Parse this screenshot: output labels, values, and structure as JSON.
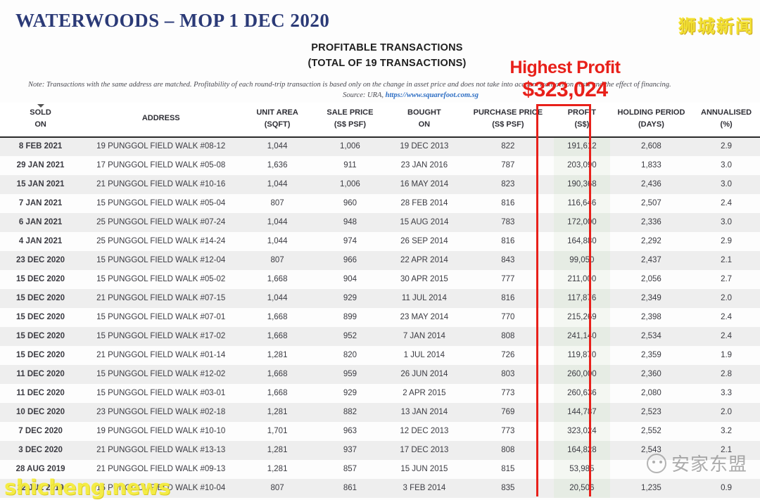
{
  "title": "WATERWOODS – MOP 1 DEC 2020",
  "watermarks": {
    "top_right": "狮城新闻",
    "bottom_left": "shicheng.news",
    "bottom_right": "安家东盟"
  },
  "heading": {
    "line1": "PROFITABLE TRANSACTIONS",
    "line2": "(TOTAL OF 19 TRANSACTIONS)"
  },
  "note": {
    "text": "Note: Transactions with the same address are matched. Profitability of each round-trip transaction is based only on the change in asset price and does not take into account transaction costs and the effect of financing.",
    "source_label": "Source: URA,",
    "source_link": "https://www.squarefoot.com.sg"
  },
  "callout": {
    "label": "Highest Profit",
    "value": "$323,024",
    "color": "#e8201a"
  },
  "colors": {
    "title": "#2b3a77",
    "highlight": "#e8201a",
    "header_sorted_bg": "#cfdce8",
    "row_odd": "#eeeeee",
    "row_even": "#fdfdfd",
    "profit_col": "#e6ece4"
  },
  "table": {
    "columns": [
      {
        "key": "sold_on",
        "line1": "SOLD",
        "line2": "ON",
        "sorted": true
      },
      {
        "key": "address",
        "line1": "ADDRESS",
        "line2": "",
        "sorted": false
      },
      {
        "key": "unit_area",
        "line1": "UNIT AREA",
        "line2": "(SQFT)",
        "sorted": false
      },
      {
        "key": "sale_price",
        "line1": "SALE PRICE",
        "line2": "(S$ PSF)",
        "sorted": false
      },
      {
        "key": "bought_on",
        "line1": "BOUGHT",
        "line2": "ON",
        "sorted": false
      },
      {
        "key": "purchase_price",
        "line1": "PURCHASE PRICE",
        "line2": "(S$ PSF)",
        "sorted": false
      },
      {
        "key": "profit",
        "line1": "PROFIT",
        "line2": "(S$)",
        "sorted": false,
        "highlighted": true
      },
      {
        "key": "holding_period",
        "line1": "HOLDING PERIOD",
        "line2": "(DAYS)",
        "sorted": false
      },
      {
        "key": "annualised",
        "line1": "ANNUALISED",
        "line2": "(%)",
        "sorted": false
      }
    ],
    "rows": [
      [
        "8 FEB 2021",
        "19 PUNGGOL FIELD WALK #08-12",
        "1,044",
        "1,006",
        "19 DEC 2013",
        "822",
        "191,612",
        "2,608",
        "2.9"
      ],
      [
        "29 JAN 2021",
        "17 PUNGGOL FIELD WALK #05-08",
        "1,636",
        "911",
        "23 JAN 2016",
        "787",
        "203,090",
        "1,833",
        "3.0"
      ],
      [
        "15 JAN 2021",
        "21 PUNGGOL FIELD WALK #10-16",
        "1,044",
        "1,006",
        "16 MAY 2014",
        "823",
        "190,368",
        "2,436",
        "3.0"
      ],
      [
        "7 JAN 2021",
        "15 PUNGGOL FIELD WALK #05-04",
        "807",
        "960",
        "28 FEB 2014",
        "816",
        "116,646",
        "2,507",
        "2.4"
      ],
      [
        "6 JAN 2021",
        "25 PUNGGOL FIELD WALK #07-24",
        "1,044",
        "948",
        "15 AUG 2014",
        "783",
        "172,000",
        "2,336",
        "3.0"
      ],
      [
        "4 JAN 2021",
        "25 PUNGGOL FIELD WALK #14-24",
        "1,044",
        "974",
        "26 SEP 2014",
        "816",
        "164,880",
        "2,292",
        "2.9"
      ],
      [
        "23 DEC 2020",
        "15 PUNGGOL FIELD WALK #12-04",
        "807",
        "966",
        "22 APR 2014",
        "843",
        "99,050",
        "2,437",
        "2.1"
      ],
      [
        "15 DEC 2020",
        "15 PUNGGOL FIELD WALK #05-02",
        "1,668",
        "904",
        "30 APR 2015",
        "777",
        "211,000",
        "2,056",
        "2.7"
      ],
      [
        "15 DEC 2020",
        "21 PUNGGOL FIELD WALK #07-15",
        "1,044",
        "929",
        "11 JUL 2014",
        "816",
        "117,876",
        "2,349",
        "2.0"
      ],
      [
        "15 DEC 2020",
        "15 PUNGGOL FIELD WALK #07-01",
        "1,668",
        "899",
        "23 MAY 2014",
        "770",
        "215,269",
        "2,398",
        "2.4"
      ],
      [
        "15 DEC 2020",
        "15 PUNGGOL FIELD WALK #17-02",
        "1,668",
        "952",
        "7 JAN 2014",
        "808",
        "241,140",
        "2,534",
        "2.4"
      ],
      [
        "15 DEC 2020",
        "21 PUNGGOL FIELD WALK #01-14",
        "1,281",
        "820",
        "1 JUL 2014",
        "726",
        "119,870",
        "2,359",
        "1.9"
      ],
      [
        "11 DEC 2020",
        "15 PUNGGOL FIELD WALK #12-02",
        "1,668",
        "959",
        "26 JUN 2014",
        "803",
        "260,000",
        "2,360",
        "2.8"
      ],
      [
        "11 DEC 2020",
        "15 PUNGGOL FIELD WALK #03-01",
        "1,668",
        "929",
        "2 APR 2015",
        "773",
        "260,636",
        "2,080",
        "3.3"
      ],
      [
        "10 DEC 2020",
        "23 PUNGGOL FIELD WALK #02-18",
        "1,281",
        "882",
        "13 JAN 2014",
        "769",
        "144,787",
        "2,523",
        "2.0"
      ],
      [
        "7 DEC 2020",
        "19 PUNGGOL FIELD WALK #10-10",
        "1,701",
        "963",
        "12 DEC 2013",
        "773",
        "323,024",
        "2,552",
        "3.2"
      ],
      [
        "3 DEC 2020",
        "21 PUNGGOL FIELD WALK #13-13",
        "1,281",
        "937",
        "17 DEC 2013",
        "808",
        "164,828",
        "2,543",
        "2.1"
      ],
      [
        "28 AUG 2019",
        "21 PUNGGOL FIELD WALK #09-13",
        "1,281",
        "857",
        "15 JUN 2015",
        "815",
        "53,985",
        "",
        ""
      ],
      [
        "22 JUL 2019",
        "15 PUNGGOL FIELD WALK #10-04",
        "807",
        "861",
        "3 FEB 2014",
        "835",
        "20,506",
        "1,235",
        "0.9"
      ]
    ]
  }
}
